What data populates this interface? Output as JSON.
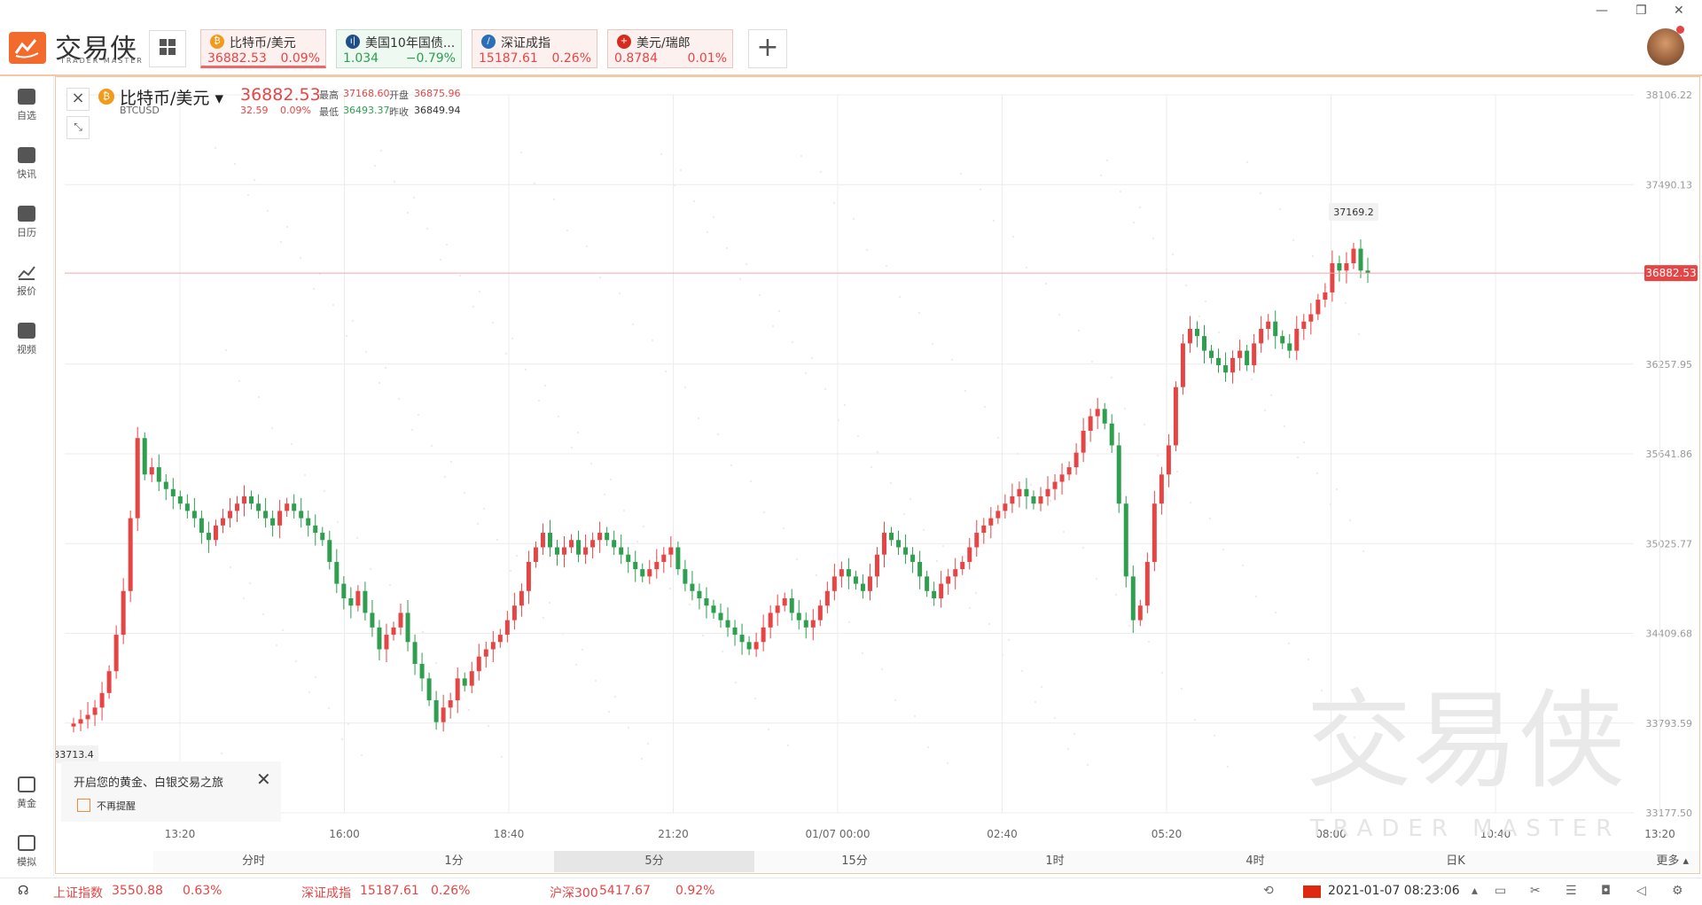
{
  "app": {
    "logo_text": "交易侠",
    "logo_sub": "TRADER MASTER"
  },
  "tabs": [
    {
      "name": "比特币/美元",
      "price": "36882.53",
      "change": "0.09%",
      "trend": "up",
      "icon": "bitcoin-icon"
    },
    {
      "name": "美国10年国债...",
      "price": "1.034",
      "change": "−0.79%",
      "trend": "down",
      "icon": "bond-icon"
    },
    {
      "name": "深证成指",
      "price": "15187.61",
      "change": "0.26%",
      "trend": "up",
      "icon": "index-icon"
    },
    {
      "name": "美元/瑞郎",
      "price": "0.8784",
      "change": "0.01%",
      "trend": "up",
      "icon": "flag-icon"
    }
  ],
  "sidebar": {
    "items": [
      {
        "label": "自选",
        "icon": "bookmark-add-icon"
      },
      {
        "label": "快讯",
        "icon": "news-icon"
      },
      {
        "label": "日历",
        "icon": "calendar-icon"
      },
      {
        "label": "报价",
        "icon": "line-chart-icon"
      },
      {
        "label": "视频",
        "icon": "video-play-icon"
      }
    ],
    "bottom_items": [
      {
        "label": "黄金",
        "icon": "gold-icon"
      },
      {
        "label": "模拟",
        "icon": "wallet-icon"
      }
    ]
  },
  "symbol": {
    "name": "比特币/美元",
    "code": "BTCUSD",
    "price": "36882.53",
    "change": "32.59",
    "change_pct": "0.09%",
    "high_label": "最高",
    "high": "37168.60",
    "open_label": "开盘",
    "open": "36875.96",
    "low_label": "最低",
    "low": "36493.37",
    "prev_label": "昨收",
    "prev": "36849.94"
  },
  "chart_data": {
    "type": "candlestick",
    "y_ticks": [
      "38106.22",
      "37490.13",
      "36257.95",
      "35641.86",
      "35025.77",
      "34409.68",
      "33793.59",
      "33177.50"
    ],
    "x_ticks": [
      "13:20",
      "16:00",
      "18:40",
      "21:20",
      "01/07 00:00",
      "02:40",
      "05:20",
      "08:00",
      "10:40",
      "13:20"
    ],
    "current_price": "36882.53",
    "max_label": "37169.2",
    "min_label": "33713.4",
    "ylim": [
      33177.5,
      38106.22
    ],
    "path_hint": [
      33790,
      33820,
      33850,
      33900,
      34000,
      34150,
      34400,
      34700,
      35200,
      35750,
      35500,
      35550,
      35450,
      35400,
      35350,
      35300,
      35250,
      35200,
      35100,
      35050,
      35150,
      35200,
      35250,
      35300,
      35350,
      35300,
      35250,
      35200,
      35150,
      35250,
      35300,
      35250,
      35200,
      35150,
      35100,
      35050,
      34900,
      34750,
      34650,
      34600,
      34700,
      34550,
      34450,
      34300,
      34400,
      34450,
      34550,
      34350,
      34200,
      34100,
      33950,
      33800,
      33900,
      33950,
      34100,
      34050,
      34150,
      34250,
      34300,
      34350,
      34400,
      34500,
      34600,
      34700,
      34900,
      35000,
      35100,
      35000,
      34950,
      35000,
      35050,
      34950,
      35000,
      35050,
      35100,
      35050,
      35000,
      34950,
      34900,
      34850,
      34800,
      34850,
      34900,
      34950,
      35000,
      34850,
      34750,
      34700,
      34650,
      34600,
      34550,
      34500,
      34450,
      34400,
      34350,
      34300,
      34350,
      34450,
      34550,
      34600,
      34650,
      34550,
      34500,
      34450,
      34500,
      34600,
      34700,
      34800,
      34850,
      34800,
      34750,
      34700,
      34800,
      34950,
      35100,
      35050,
      35000,
      34950,
      34900,
      34800,
      34700,
      34650,
      34750,
      34800,
      34850,
      34900,
      35000,
      35100,
      35150,
      35200,
      35250,
      35300,
      35350,
      35400,
      35350,
      35300,
      35350,
      35400,
      35450,
      35500,
      35550,
      35650,
      35800,
      35900,
      35950,
      35850,
      35700,
      35300,
      34800,
      34500,
      34600,
      34900,
      35300,
      35500,
      35700,
      36100,
      36400,
      36500,
      36450,
      36350,
      36300,
      36250,
      36200,
      36300,
      36350,
      36250,
      36400,
      36500,
      36550,
      36450,
      36400,
      36350,
      36500,
      36550,
      36600,
      36700,
      36750,
      36950,
      36900,
      36950,
      37050,
      36900,
      36880
    ]
  },
  "promo": {
    "text": "开启您的黄金、白银交易之旅",
    "remind": "不再提醒"
  },
  "periods": [
    "分时",
    "1分",
    "5分",
    "15分",
    "1时",
    "4时",
    "日K",
    "更多"
  ],
  "active_period": "5分",
  "watermark": {
    "text": "交易侠",
    "sub": "TRADER MASTER"
  },
  "statusbar": [
    {
      "name": "上证指数",
      "value": "3550.88",
      "pct": "0.63%"
    },
    {
      "name": "深证成指",
      "value": "15187.61",
      "pct": "0.26%"
    },
    {
      "name": "沪深300",
      "value": "5417.67",
      "pct": "0.92%"
    }
  ],
  "datetime": "2021-01-07 08:23:06"
}
